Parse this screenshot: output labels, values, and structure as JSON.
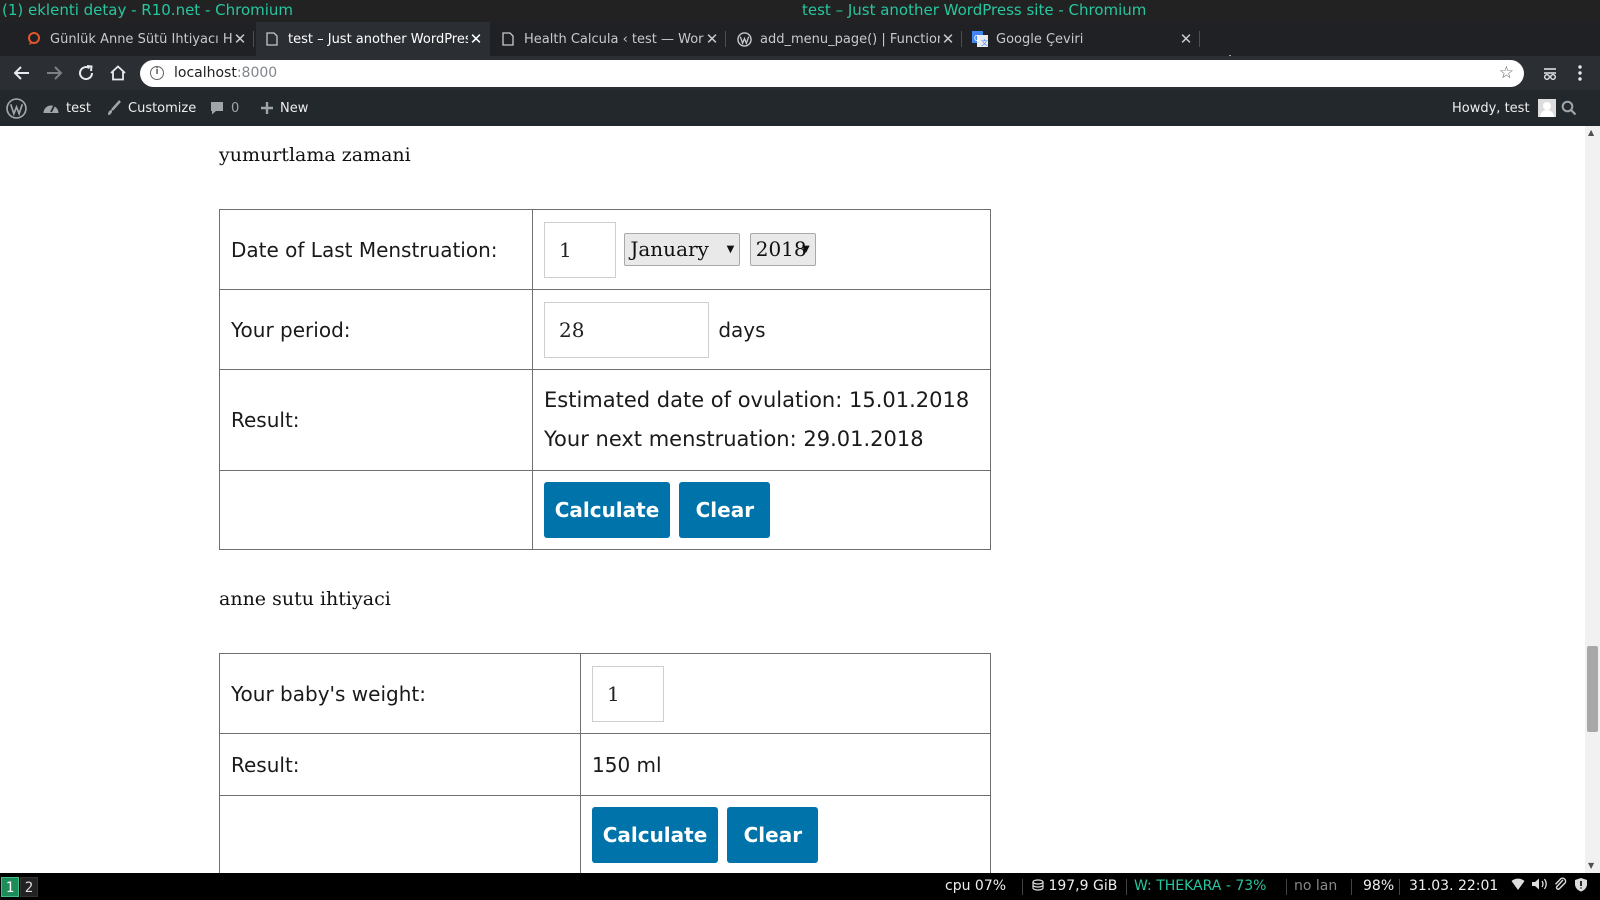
{
  "window": {
    "left_title": "(1) eklenti detay - R10.net - Chromium",
    "center_title": "test – Just another WordPress site - Chromium"
  },
  "tabs": [
    {
      "title": "Günlük Anne Sütü İhtiyacı Hesaplama",
      "icon": "comment-favicon-icon",
      "active": false
    },
    {
      "title": "test – Just another WordPress site",
      "icon": "page-icon",
      "active": true
    },
    {
      "title": "Health Calcula ‹ test — WordPress",
      "icon": "page-icon",
      "active": false
    },
    {
      "title": "add_menu_page() | Function",
      "icon": "wordpress-icon",
      "active": false
    },
    {
      "title": "Google Çeviri",
      "icon": "google-translate-icon",
      "active": false
    }
  ],
  "toolbar": {
    "url_host": "localhost",
    "url_port": ":8000"
  },
  "adminbar": {
    "site_name": "test",
    "customize": "Customize",
    "comments_count": "0",
    "new": "New",
    "howdy": "Howdy, test"
  },
  "ovulation": {
    "heading": "yumurtlama zamani",
    "last_menstruation_label": "Date of Last Menstruation:",
    "day_value": "1",
    "month_value": "January",
    "year_value": "2018",
    "period_label": "Your period:",
    "period_value": "28",
    "period_unit": "days",
    "result_label": "Result:",
    "result_ovulation": "Estimated date of ovulation: 15.01.2018",
    "result_next": "Your next menstruation: 29.01.2018",
    "calculate_label": "Calculate",
    "clear_label": "Clear"
  },
  "milk": {
    "heading": "anne sutu ihtiyaci",
    "weight_label": "Your baby's weight:",
    "weight_value": "1",
    "result_label": "Result:",
    "result_value": "150 ml",
    "calculate_label": "Calculate",
    "clear_label": "Clear"
  },
  "statusbar": {
    "workspaces": [
      "1",
      "2"
    ],
    "cpu": "cpu  07%",
    "disk": "197,9 GiB",
    "wifi": "W: THEKARA -  73%",
    "lan": "no lan",
    "battery": "98%",
    "datetime": "31.03. 22:01"
  },
  "colors": {
    "accent_button": "#0073aa",
    "status_green": "#27c6a0",
    "adminbar_bg": "#23282d"
  }
}
